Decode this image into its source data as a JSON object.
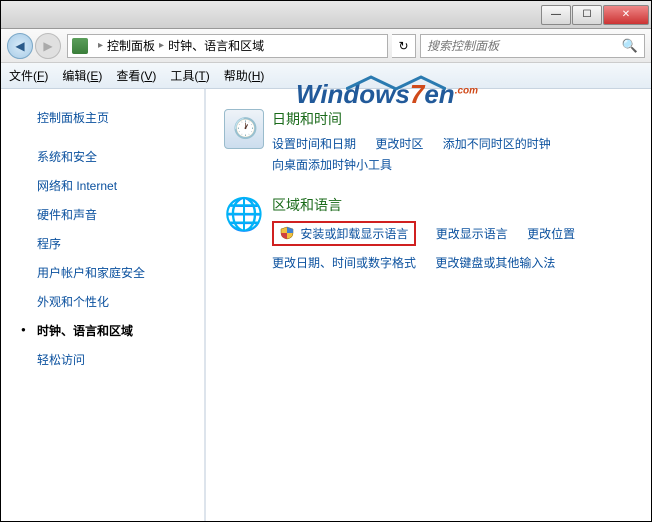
{
  "title_buttons": {
    "min": "—",
    "max": "☐",
    "close": "✕"
  },
  "nav": {
    "back": "◀",
    "forward": "▶"
  },
  "breadcrumb": {
    "item1": "控制面板",
    "item2": "时钟、语言和区域"
  },
  "refresh_glyph": "↻",
  "search": {
    "placeholder": "搜索控制面板",
    "icon": "🔍"
  },
  "menu": {
    "file": "文件(",
    "file_u": "F",
    "file2": ")",
    "edit": "编辑(",
    "edit_u": "E",
    "edit2": ")",
    "view": "查看(",
    "view_u": "V",
    "view2": ")",
    "tools": "工具(",
    "tools_u": "T",
    "tools2": ")",
    "help": "帮助(",
    "help_u": "H",
    "help2": ")"
  },
  "sidebar": {
    "head": "控制面板主页",
    "items": [
      "系统和安全",
      "网络和 Internet",
      "硬件和声音",
      "程序",
      "用户帐户和家庭安全",
      "外观和个性化",
      "时钟、语言和区域",
      "轻松访问"
    ],
    "active_index": 6
  },
  "watermark": {
    "t1": "W",
    "t2": "indows",
    "t3": "7",
    "t4": "en",
    "dot": ".com"
  },
  "sections": [
    {
      "title": "日期和时间",
      "links_row1": [
        "设置时间和日期",
        "更改时区",
        "添加不同时区的时钟"
      ],
      "links_row2": [
        "向桌面添加时钟小工具"
      ]
    },
    {
      "title": "区域和语言",
      "highlighted": "安装或卸载显示语言",
      "links_row1": [
        "更改显示语言",
        "更改位置"
      ],
      "links_row2": [
        "更改日期、时间或数字格式",
        "更改键盘或其他输入法"
      ]
    }
  ]
}
